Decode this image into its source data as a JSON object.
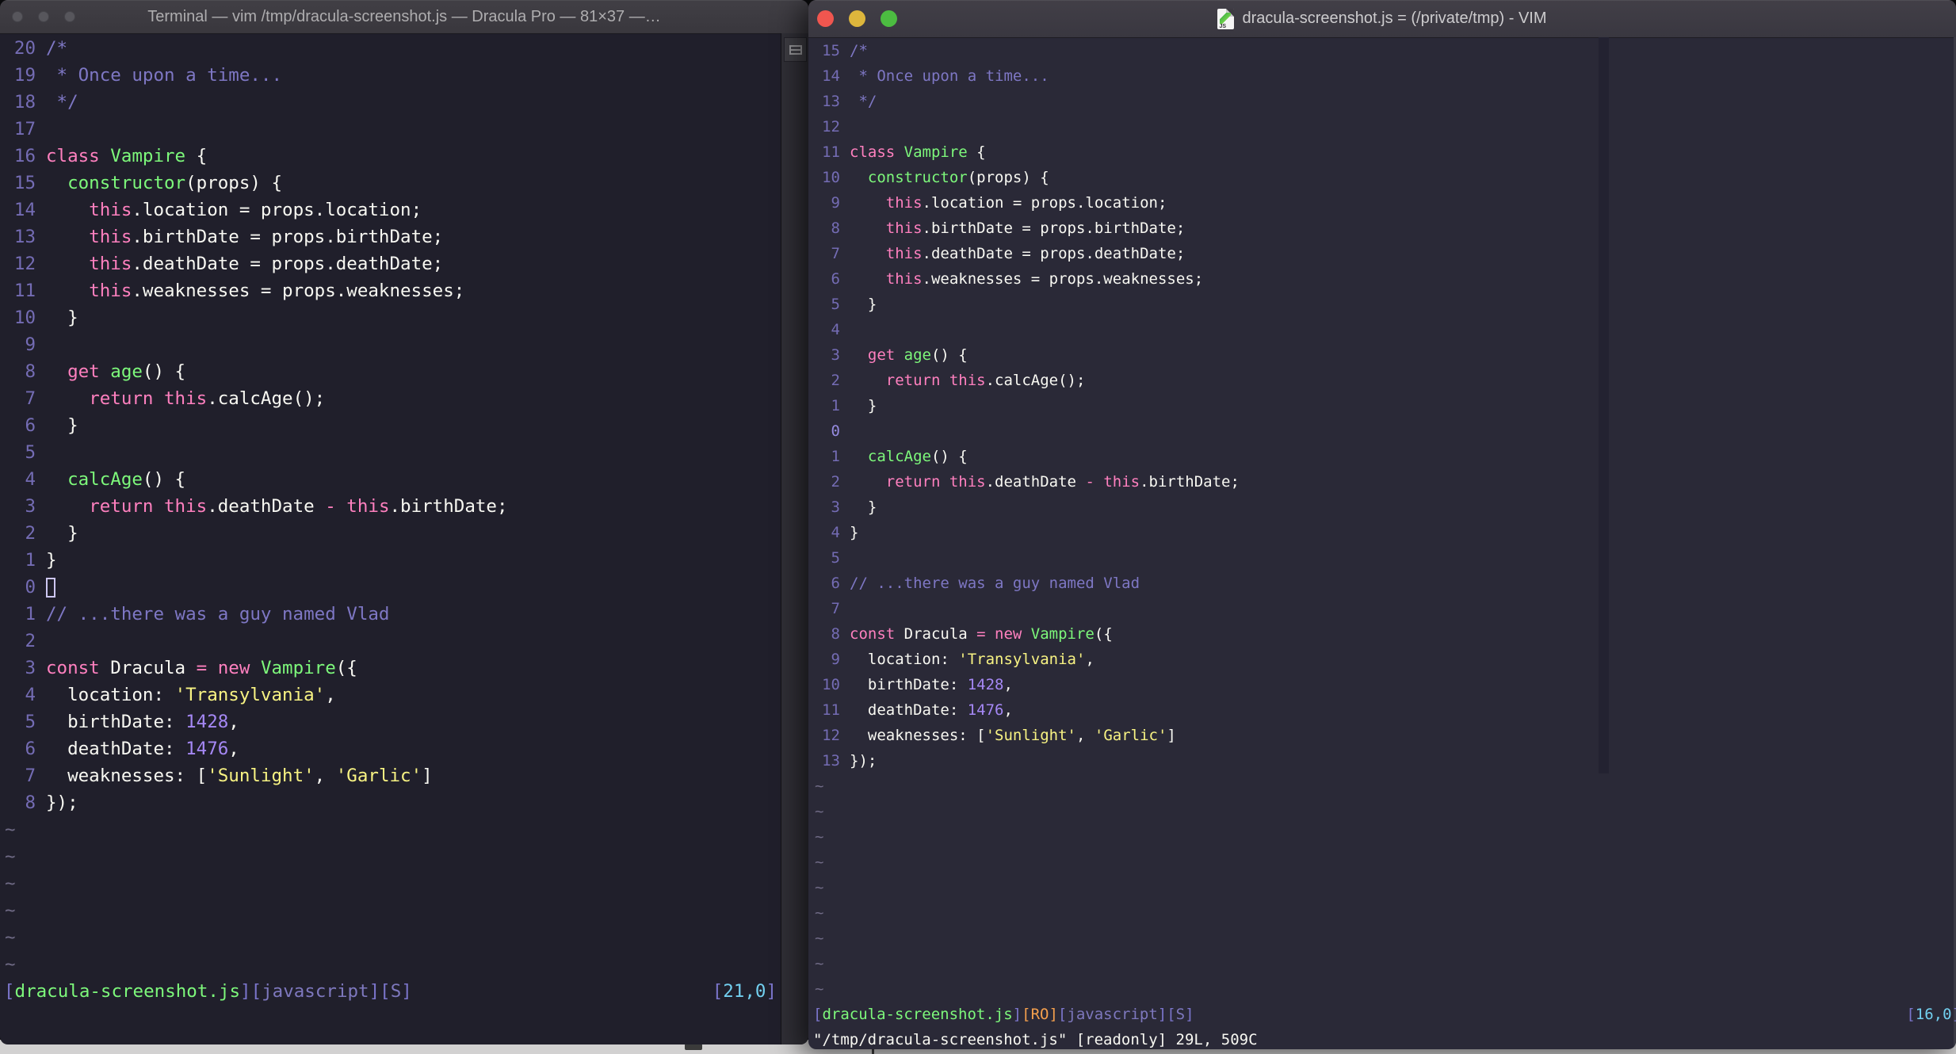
{
  "palette": {
    "bg_left": "#201F2B",
    "bg_right": "#2A2937",
    "fg": "#F8F8F2",
    "comment": "#7E77C4",
    "linenr": "#746CB4",
    "curlinenr": "#968BE0",
    "pink": "#FF80BF",
    "green": "#7DF87B",
    "yellow": "#F8F383",
    "purple": "#A588F5",
    "cyan": "#72CFEF",
    "orange": "#F5A04D",
    "tilde": "#6F6A85",
    "sbracket": "#7B75CB",
    "smeta": "#7E78BE",
    "sfile": "#7DF87B",
    "titlebar_left": "#3C3A41",
    "titlebar_right": "#3D3A42",
    "title_text_left": "#AEADAF",
    "title_text_right": "#CDCCCE",
    "light_red": "#F0564F",
    "light_yellow": "#DDB63C",
    "light_green": "#4CBC41",
    "light_inactive": "#57565C",
    "strip": "#D2D1D1"
  },
  "left_window": {
    "title": "Terminal — vim /tmp/dracula-screenshot.js — Dracula Pro — 81×37 —…",
    "status_segments": [
      [
        "[",
        "sb"
      ],
      [
        "dracula-screenshot.js",
        "sfile"
      ],
      [
        "]",
        "sb"
      ],
      [
        "[",
        "sb"
      ],
      [
        "javascript",
        "smeta"
      ],
      [
        "]",
        "sb"
      ],
      [
        "[",
        "sb"
      ],
      [
        "S",
        "smeta"
      ],
      [
        "]",
        "sb"
      ]
    ],
    "cursor_pos_segments": [
      [
        "[",
        "sb"
      ],
      [
        "21,0",
        "cyan"
      ],
      [
        "]",
        "sb"
      ]
    ],
    "command_line_segments": []
  },
  "right_window": {
    "title": "dracula-screenshot.js = (/private/tmp) - VIM",
    "status_segments": [
      [
        "[",
        "sb"
      ],
      [
        "dracula-screenshot.js",
        "sfile"
      ],
      [
        "]",
        "sb"
      ],
      [
        "[",
        "ro"
      ],
      [
        "RO",
        "ro"
      ],
      [
        "]",
        "ro"
      ],
      [
        "[",
        "sb"
      ],
      [
        "javascript",
        "smeta"
      ],
      [
        "]",
        "sb"
      ],
      [
        "[",
        "sb"
      ],
      [
        "S",
        "smeta"
      ],
      [
        "]",
        "sb"
      ]
    ],
    "cursor_pos_segments": [
      [
        "[",
        "sb"
      ],
      [
        "16,0",
        "cyan"
      ],
      [
        "]",
        "sb"
      ]
    ],
    "command_line_segments": [
      [
        "\"/tmp/dracula-screenshot.js\" [readonly] 29L, 509C",
        "fg"
      ]
    ]
  },
  "editors": {
    "code_lines": [
      [
        [
          "/*",
          "comment"
        ]
      ],
      [
        [
          " * Once upon a time...",
          "comment"
        ]
      ],
      [
        [
          " */",
          "comment"
        ]
      ],
      [],
      [
        [
          "class ",
          "pink"
        ],
        [
          "Vampire",
          "green"
        ],
        [
          " {",
          "fg"
        ]
      ],
      [
        [
          "  ",
          "fg"
        ],
        [
          "constructor",
          "green"
        ],
        [
          "(props) {",
          "fg"
        ]
      ],
      [
        [
          "    ",
          "fg"
        ],
        [
          "this",
          "pink"
        ],
        [
          ".location = props.location;",
          "fg"
        ]
      ],
      [
        [
          "    ",
          "fg"
        ],
        [
          "this",
          "pink"
        ],
        [
          ".birthDate = props.birthDate;",
          "fg"
        ]
      ],
      [
        [
          "    ",
          "fg"
        ],
        [
          "this",
          "pink"
        ],
        [
          ".deathDate = props.deathDate;",
          "fg"
        ]
      ],
      [
        [
          "    ",
          "fg"
        ],
        [
          "this",
          "pink"
        ],
        [
          ".weaknesses = props.weaknesses;",
          "fg"
        ]
      ],
      [
        [
          "  }",
          "fg"
        ]
      ],
      [],
      [
        [
          "  ",
          "fg"
        ],
        [
          "get ",
          "pink"
        ],
        [
          "age",
          "green"
        ],
        [
          "() {",
          "fg"
        ]
      ],
      [
        [
          "    ",
          "fg"
        ],
        [
          "return this",
          "pink"
        ],
        [
          ".calcAge();",
          "fg"
        ]
      ],
      [
        [
          "  }",
          "fg"
        ]
      ],
      [],
      [
        [
          "  ",
          "fg"
        ],
        [
          "calcAge",
          "green"
        ],
        [
          "() {",
          "fg"
        ]
      ],
      [
        [
          "    ",
          "fg"
        ],
        [
          "return this",
          "pink"
        ],
        [
          ".deathDate ",
          "fg"
        ],
        [
          "- this",
          "pink"
        ],
        [
          ".birthDate;",
          "fg"
        ]
      ],
      [
        [
          "  }",
          "fg"
        ]
      ],
      [
        [
          "}",
          "fg"
        ]
      ],
      [],
      [
        [
          "// ...there was a guy named Vlad",
          "comment"
        ]
      ],
      [],
      [
        [
          "const ",
          "pink"
        ],
        [
          "Dracula ",
          "fg"
        ],
        [
          "= new ",
          "pink"
        ],
        [
          "Vampire",
          "green"
        ],
        [
          "({",
          "fg"
        ]
      ],
      [
        [
          "  location: ",
          "fg"
        ],
        [
          "'Transylvania'",
          "yellow"
        ],
        [
          ",",
          "fg"
        ]
      ],
      [
        [
          "  birthDate: ",
          "fg"
        ],
        [
          "1428",
          "purple"
        ],
        [
          ",",
          "fg"
        ]
      ],
      [
        [
          "  deathDate: ",
          "fg"
        ],
        [
          "1476",
          "purple"
        ],
        [
          ",",
          "fg"
        ]
      ],
      [
        [
          "  weaknesses: [",
          "fg"
        ],
        [
          "'Sunlight'",
          "yellow"
        ],
        [
          ", ",
          "fg"
        ],
        [
          "'Garlic'",
          "yellow"
        ],
        [
          "]",
          "fg"
        ]
      ],
      [
        [
          "});",
          "fg"
        ]
      ]
    ],
    "views": [
      {
        "id": "left",
        "numbers": [
          "20",
          "19",
          "18",
          "17",
          "16",
          "15",
          "14",
          "13",
          "12",
          "11",
          "10",
          "9",
          "8",
          "7",
          "6",
          "5",
          "4",
          "3",
          "2",
          "1",
          "0",
          "1",
          "2",
          "3",
          "4",
          "5",
          "6",
          "7",
          "8"
        ],
        "cursor_index": 20,
        "cursor_style": "hollow",
        "highlight_cursor_number": false,
        "tildes": 6
      },
      {
        "id": "right",
        "numbers": [
          "15",
          "14",
          "13",
          "12",
          "11",
          "10",
          "9",
          "8",
          "7",
          "6",
          "5",
          "4",
          "3",
          "2",
          "1",
          "0",
          "1",
          "2",
          "3",
          "4",
          "5",
          "6",
          "7",
          "8",
          "9",
          "10",
          "11",
          "12",
          "13"
        ],
        "cursor_index": 15,
        "cursor_style": "none",
        "highlight_cursor_number": true,
        "tildes": 9
      }
    ]
  }
}
